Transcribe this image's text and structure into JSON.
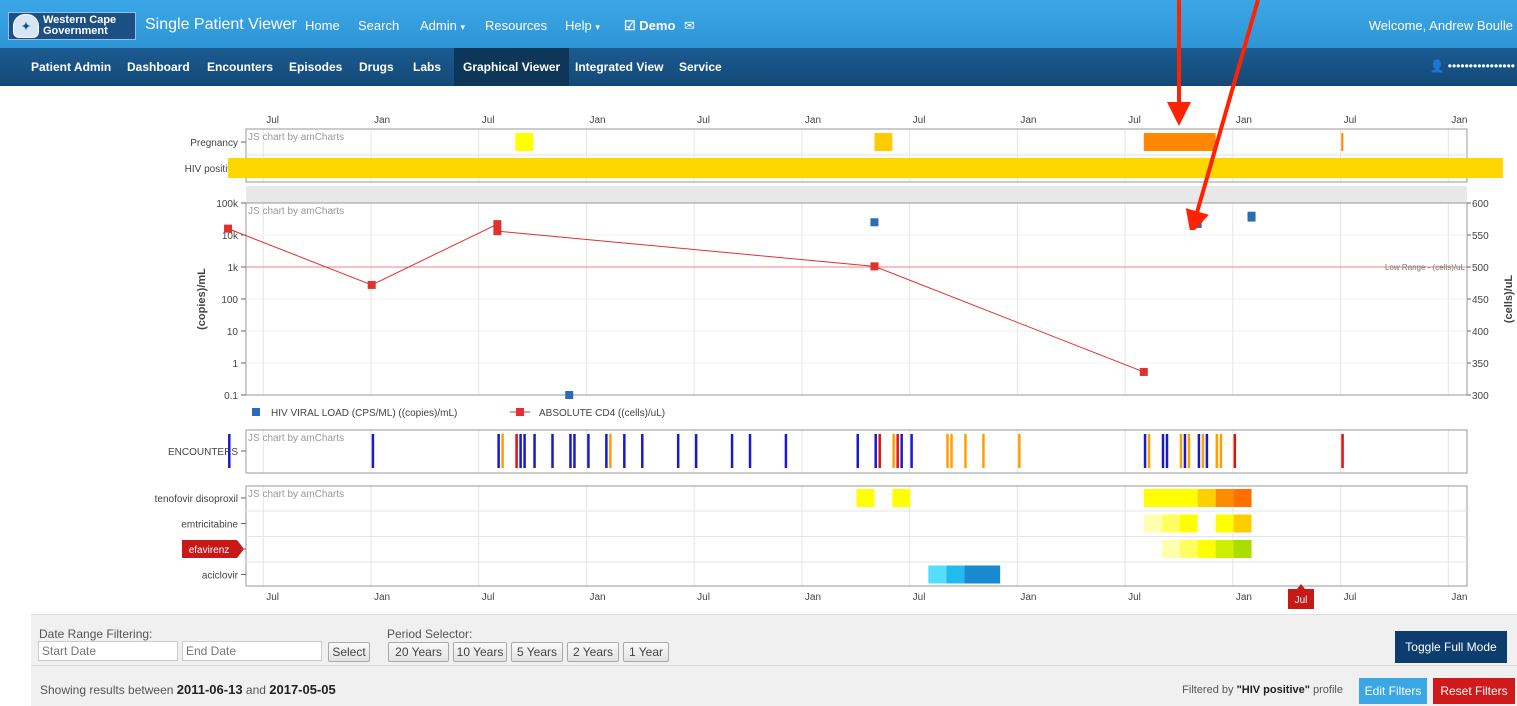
{
  "header": {
    "logo_line1": "Western Cape",
    "logo_line2": "Government",
    "brand": "Single Patient Viewer",
    "nav": [
      {
        "label": "Home"
      },
      {
        "label": "Search"
      },
      {
        "label": "Admin"
      },
      {
        "label": "Resources"
      },
      {
        "label": "Help"
      },
      {
        "label": "Demo"
      }
    ],
    "welcome": "Welcome, Andrew Boulle"
  },
  "subnav": {
    "items": [
      {
        "label": "Patient Admin"
      },
      {
        "label": "Dashboard"
      },
      {
        "label": "Encounters"
      },
      {
        "label": "Episodes"
      },
      {
        "label": "Drugs"
      },
      {
        "label": "Labs"
      },
      {
        "label": "Graphical Viewer"
      },
      {
        "label": "Integrated View"
      },
      {
        "label": "Service"
      }
    ],
    "active": "Graphical Viewer",
    "user_mask": "••••••••••••••••"
  },
  "chart_data": {
    "watermark": "JS chart by amCharts",
    "time_ticks": [
      "Jul",
      "Jan",
      "Jul",
      "Jan",
      "Jul",
      "Jan",
      "Jul",
      "Jan",
      "Jul",
      "Jan",
      "Jul",
      "Jan"
    ],
    "conditions": {
      "type": "timeline",
      "rows": [
        "Pregnancy",
        "HIV positive"
      ],
      "bars": [
        {
          "row": "Pregnancy",
          "start": "2012-10",
          "end": "2012-11",
          "color": "#ffff00"
        },
        {
          "row": "Pregnancy",
          "start": "2014-06",
          "end": "2014-07",
          "color": "#ffcc00"
        },
        {
          "row": "Pregnancy",
          "start": "2015-09",
          "end": "2016-01",
          "color": "#ff8800"
        },
        {
          "row": "Pregnancy",
          "start": "2016-08",
          "end": "2016-08",
          "color": "#ff8800"
        },
        {
          "row": "HIV positive",
          "start": "2011-06",
          "end": "2017-05",
          "color": "#ffd700"
        }
      ]
    },
    "labs": {
      "type": "scatter+line",
      "left_axis": {
        "label": "(copies)/mL",
        "ticks": [
          "100k",
          "10k",
          "1k",
          "100",
          "10",
          "1",
          "0.1"
        ],
        "scale": "log"
      },
      "right_axis": {
        "label": "(cells)/uL",
        "ticks": [
          600,
          550,
          500,
          450,
          400,
          350,
          300
        ],
        "range": [
          300,
          600
        ]
      },
      "guide_label": "Low Range - (cells)/uL",
      "guide_value": 500,
      "series": [
        {
          "name": "HIV VIRAL LOAD (CPS/ML) ((copies)/mL)",
          "color": "#2b6cb8",
          "axis": "left",
          "points": [
            {
              "x": "2013-01",
              "y": 0.1
            },
            {
              "x": "2014-06",
              "y": 25000
            },
            {
              "x": "2015-12",
              "y": 22000
            },
            {
              "x": "2016-03",
              "y": 40000
            },
            {
              "x": "2016-03",
              "y": 35000
            }
          ]
        },
        {
          "name": "ABSOLUTE CD4 ((cells)/uL)",
          "color": "#e03030",
          "axis": "right",
          "points": [
            {
              "x": "2011-06",
              "y": 560
            },
            {
              "x": "2012-02",
              "y": 472
            },
            {
              "x": "2012-09",
              "y": 567
            },
            {
              "x": "2012-09",
              "y": 556
            },
            {
              "x": "2014-06",
              "y": 501
            },
            {
              "x": "2015-09",
              "y": 336
            }
          ]
        }
      ]
    },
    "encounters": {
      "type": "timeline",
      "row": "ENCOUNTERS",
      "colors": {
        "blue": "#1a1acc",
        "orange": "#ffa000",
        "red": "#dd1111"
      },
      "events": [
        {
          "date": "2011-06",
          "color": "blue"
        },
        {
          "date": "2012-02",
          "color": "blue"
        },
        {
          "date": "2012-09",
          "color": "blue"
        },
        {
          "date": "2012-09",
          "color": "orange"
        },
        {
          "date": "2012-10",
          "color": "red"
        },
        {
          "date": "2012-10",
          "color": "blue"
        },
        {
          "date": "2012-10",
          "color": "blue"
        },
        {
          "date": "2012-11",
          "color": "blue"
        },
        {
          "date": "2012-12",
          "color": "blue"
        },
        {
          "date": "2013-01",
          "color": "blue"
        },
        {
          "date": "2013-01",
          "color": "blue"
        },
        {
          "date": "2013-02",
          "color": "blue"
        },
        {
          "date": "2013-03",
          "color": "blue"
        },
        {
          "date": "2013-03",
          "color": "orange"
        },
        {
          "date": "2013-04",
          "color": "blue"
        },
        {
          "date": "2013-05",
          "color": "blue"
        },
        {
          "date": "2013-07",
          "color": "blue"
        },
        {
          "date": "2013-08",
          "color": "blue"
        },
        {
          "date": "2013-10",
          "color": "blue"
        },
        {
          "date": "2013-11",
          "color": "blue"
        },
        {
          "date": "2014-01",
          "color": "blue"
        },
        {
          "date": "2014-05",
          "color": "blue"
        },
        {
          "date": "2014-06",
          "color": "blue"
        },
        {
          "date": "2014-06",
          "color": "red"
        },
        {
          "date": "2014-07",
          "color": "orange"
        },
        {
          "date": "2014-07",
          "color": "red"
        },
        {
          "date": "2014-07",
          "color": "blue"
        },
        {
          "date": "2014-08",
          "color": "blue"
        },
        {
          "date": "2014-10",
          "color": "orange"
        },
        {
          "date": "2014-10",
          "color": "orange"
        },
        {
          "date": "2014-11",
          "color": "orange"
        },
        {
          "date": "2014-12",
          "color": "orange"
        },
        {
          "date": "2015-02",
          "color": "orange"
        },
        {
          "date": "2015-09",
          "color": "blue"
        },
        {
          "date": "2015-09",
          "color": "orange"
        },
        {
          "date": "2015-10",
          "color": "blue"
        },
        {
          "date": "2015-10",
          "color": "blue"
        },
        {
          "date": "2015-11",
          "color": "orange"
        },
        {
          "date": "2015-11",
          "color": "blue"
        },
        {
          "date": "2015-11",
          "color": "orange"
        },
        {
          "date": "2015-12",
          "color": "blue"
        },
        {
          "date": "2015-12",
          "color": "orange"
        },
        {
          "date": "2015-12",
          "color": "blue"
        },
        {
          "date": "2016-01",
          "color": "orange"
        },
        {
          "date": "2016-01",
          "color": "orange"
        },
        {
          "date": "2016-02",
          "color": "red"
        },
        {
          "date": "2016-08",
          "color": "red"
        }
      ]
    },
    "drugs": {
      "type": "timeline",
      "rows": [
        "tenofovir disoproxil",
        "emtricitabine",
        "efavirenz",
        "aciclovir"
      ],
      "highlighted_row": "efavirenz",
      "bars": [
        {
          "row": "tenofovir disoproxil",
          "start": "2014-05",
          "end": "2014-06",
          "color": "#ffff00"
        },
        {
          "row": "tenofovir disoproxil",
          "start": "2014-07",
          "end": "2014-08",
          "color": "#ffff00"
        },
        {
          "row": "tenofovir disoproxil",
          "start": "2015-09",
          "end": "2015-12",
          "color": "#ffff00"
        },
        {
          "row": "tenofovir disoproxil",
          "start": "2015-12",
          "end": "2016-01",
          "color": "#ffd000"
        },
        {
          "row": "tenofovir disoproxil",
          "start": "2016-01",
          "end": "2016-02",
          "color": "#ff8c00"
        },
        {
          "row": "tenofovir disoproxil",
          "start": "2016-02",
          "end": "2016-03",
          "color": "#ff7000"
        },
        {
          "row": "emtricitabine",
          "start": "2015-09",
          "end": "2015-10",
          "color": "#ffffb0"
        },
        {
          "row": "emtricitabine",
          "start": "2015-10",
          "end": "2015-11",
          "color": "#ffff60"
        },
        {
          "row": "emtricitabine",
          "start": "2015-11",
          "end": "2015-12",
          "color": "#ffff00"
        },
        {
          "row": "emtricitabine",
          "start": "2016-01",
          "end": "2016-02",
          "color": "#ffff00"
        },
        {
          "row": "emtricitabine",
          "start": "2016-02",
          "end": "2016-03",
          "color": "#ffcc00"
        },
        {
          "row": "efavirenz",
          "start": "2015-10",
          "end": "2015-11",
          "color": "#ffffb0"
        },
        {
          "row": "efavirenz",
          "start": "2015-11",
          "end": "2015-12",
          "color": "#ffff60"
        },
        {
          "row": "efavirenz",
          "start": "2015-12",
          "end": "2016-01",
          "color": "#ffff00"
        },
        {
          "row": "efavirenz",
          "start": "2016-01",
          "end": "2016-02",
          "color": "#ccee00"
        },
        {
          "row": "efavirenz",
          "start": "2016-02",
          "end": "2016-03",
          "color": "#aadd00"
        },
        {
          "row": "aciclovir",
          "start": "2014-09",
          "end": "2014-10",
          "color": "#55ddff"
        },
        {
          "row": "aciclovir",
          "start": "2014-10",
          "end": "2014-11",
          "color": "#22bbee"
        },
        {
          "row": "aciclovir",
          "start": "2014-11",
          "end": "2015-01",
          "color": "#1a8ad0"
        }
      ],
      "cursor_label": "Jul"
    }
  },
  "filters": {
    "date_range_label": "Date Range Filtering:",
    "start_placeholder": "Start Date",
    "end_placeholder": "End Date",
    "select_label": "Select",
    "period_label": "Period Selector:",
    "periods": [
      {
        "label": "20 Years"
      },
      {
        "label": "10 Years"
      },
      {
        "label": "5 Years"
      },
      {
        "label": "2 Years"
      },
      {
        "label": "1 Year"
      }
    ],
    "toggle_label": "Toggle Full Mode",
    "showing_prefix": "Showing results between",
    "start_date": "2011-06-13",
    "and": "and",
    "end_date": "2017-05-05",
    "filtered_by_prefix": "Filtered by",
    "profile": "\"HIV positive\"",
    "profile_suffix": "profile",
    "edit_label": "Edit Filters",
    "reset_label": "Reset Filters"
  },
  "colors": {
    "topbar": "#3ba7e6",
    "subnav": "#1b5b91",
    "toggle": "#0d3d6e",
    "edit": "#3aa6e4",
    "reset": "#d0191b",
    "annotation_arrow": "#ff2200"
  }
}
